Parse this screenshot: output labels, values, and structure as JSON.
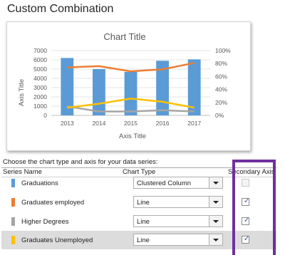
{
  "dialog": {
    "title": "Custom Combination"
  },
  "chart_data": {
    "type": "bar",
    "title": "Chart Title",
    "xlabel": "Axis Title",
    "ylabel": "Axis Title",
    "categories": [
      "2013",
      "2014",
      "2015",
      "2016",
      "2017"
    ],
    "ylim": [
      0,
      7000
    ],
    "y_ticks": [
      "0",
      "1000",
      "2000",
      "3000",
      "4000",
      "5000",
      "6000",
      "7000"
    ],
    "y2lim": [
      0,
      1.0
    ],
    "y2_ticks": [
      "0%",
      "20%",
      "40%",
      "60%",
      "80%",
      "100%"
    ],
    "series": [
      {
        "name": "Graduations",
        "type": "column",
        "axis": "primary",
        "color": "#5b9bd5",
        "values": [
          6200,
          5000,
          4700,
          5900,
          6050
        ]
      },
      {
        "name": "Graduates employed",
        "type": "line",
        "axis": "secondary",
        "color": "#ed7d31",
        "values": [
          0.74,
          0.76,
          0.68,
          0.71,
          0.81
        ]
      },
      {
        "name": "Higher Degrees",
        "type": "line",
        "axis": "secondary",
        "color": "#a5a5a5",
        "values": [
          0.14,
          0.06,
          0.06,
          0.08,
          0.06
        ]
      },
      {
        "name": "Graduates Unemployed",
        "type": "line",
        "axis": "secondary",
        "color": "#ffc000",
        "values": [
          0.12,
          0.18,
          0.26,
          0.21,
          0.12
        ]
      }
    ],
    "grid": true
  },
  "instructions": "Choose the chart type and axis for your data series:",
  "table": {
    "headers": {
      "name": "Series Name",
      "type": "Chart Type",
      "secondary": "Secondary Axis"
    },
    "rows": [
      {
        "name": "Graduations",
        "color": "#5b9bd5",
        "chart_type": "Clustered Column",
        "secondary": false,
        "secondary_enabled": false
      },
      {
        "name": "Graduates employed",
        "color": "#ed7d31",
        "chart_type": "Line",
        "secondary": true,
        "secondary_enabled": true
      },
      {
        "name": "Higher Degrees",
        "color": "#a5a5a5",
        "chart_type": "Line",
        "secondary": true,
        "secondary_enabled": true
      },
      {
        "name": "Graduates Unemployed",
        "color": "#ffc000",
        "chart_type": "Line",
        "secondary": true,
        "secondary_enabled": true
      }
    ],
    "check_glyph": "✓"
  }
}
